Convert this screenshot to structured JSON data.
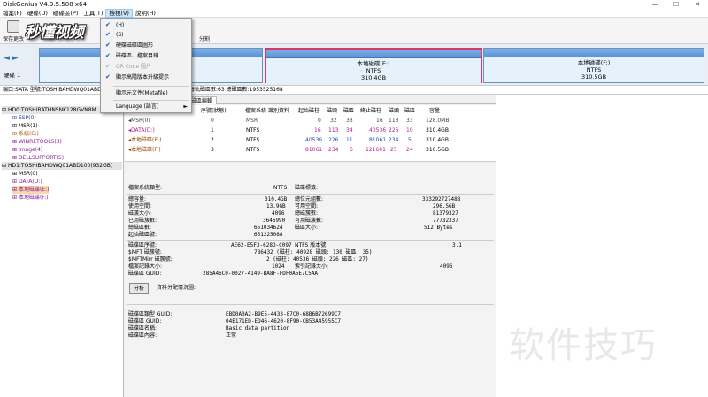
{
  "window": {
    "title": "DiskGenius V4.9.5.508 x64",
    "controls": [
      "—",
      "☐",
      "✕"
    ]
  },
  "menubar": {
    "items": [
      "檔案(F)",
      "硬碟(D)",
      "磁碟區(P)",
      "工具(T)",
      "檢視(V)",
      "說明(H)"
    ]
  },
  "toolbar": {
    "buttons": [
      "保存更改",
      "分割"
    ],
    "logo_text": "秒懂视频"
  },
  "view_menu": {
    "items": [
      {
        "label": "(H)",
        "checked": true,
        "disabled": false
      },
      {
        "label": "(S)",
        "checked": true,
        "disabled": false
      },
      {
        "label": "硬碟磁碟區圖形",
        "checked": true,
        "disabled": false
      },
      {
        "label": "磁碟區、檔案目錄",
        "checked": true,
        "disabled": false
      },
      {
        "label": "QR Code 圖片",
        "checked": true,
        "disabled": true
      },
      {
        "label": "顯示高階版本升級提示",
        "checked": true,
        "disabled": false
      },
      {
        "label": "顯示元文件(Metafile)",
        "checked": false,
        "disabled": false
      },
      {
        "label": "Language (語言)",
        "checked": false,
        "disabled": false,
        "submenu": "►"
      }
    ]
  },
  "diskmap": {
    "disk_label": "硬碟 1",
    "nav": "◄ ►",
    "partitions": [
      {
        "name": "",
        "fs": "",
        "size": ""
      },
      {
        "name": "本地磁碟(E:)",
        "fs": "NTFS",
        "size": "310.4GB"
      },
      {
        "name": "本地磁碟(F:)",
        "fs": "NTFS",
        "size": "310.5GB"
      }
    ]
  },
  "diskinfo": "端口:SATA  型號:TOSHIBAHDWQ01ABD100  ... 磁頭數:121601  磁頭數:255  每軌磁區數:63  總磁區數:1953525168",
  "tree": {
    "items": [
      {
        "text": "HD0:TOSHIBATHNSNK128GVN8M",
        "level": 0,
        "style": "hd"
      },
      {
        "text": "ESP(0)",
        "level": 1,
        "style": "blue"
      },
      {
        "text": "MSR(1)",
        "level": 1,
        "style": ""
      },
      {
        "text": "系統(C:)",
        "level": 1,
        "style": "orange"
      },
      {
        "text": "WINRETOOLS(3)",
        "level": 1,
        "style": "purple"
      },
      {
        "text": "Image(4)",
        "level": 1,
        "style": "purple"
      },
      {
        "text": "DELLSUPPORT(5)",
        "level": 1,
        "style": "purple"
      },
      {
        "text": "HD1:TOSHIBAHDWQ01ABD100(932GB)",
        "level": 0,
        "style": "hd"
      },
      {
        "text": "MSR(0)",
        "level": 1,
        "style": ""
      },
      {
        "text": "DATA(D:)",
        "level": 1,
        "style": "purple"
      },
      {
        "text": "本地磁碟(E:)",
        "level": 1,
        "style": "hl"
      },
      {
        "text": "本地磁碟(F:)",
        "level": 1,
        "style": "purple"
      }
    ]
  },
  "tabs": [
    "磁區編輯"
  ],
  "table": {
    "headers": [
      "磁碟標籤",
      "序號(狀態)",
      "檔案系統",
      "識別資料",
      "起始磁柱",
      "磁頭",
      "磁區",
      "終止磁柱",
      "磁頭",
      "磁區",
      "容量"
    ],
    "rows": [
      [
        "MSR(0)",
        "0",
        "MSR",
        "",
        "0",
        "32",
        "33",
        "16",
        "113",
        "33",
        "128.0MB"
      ],
      [
        "DATA(D:)",
        "1",
        "NTFS",
        "",
        "16",
        "113",
        "34",
        "40536",
        "226",
        "10",
        "310.4GB"
      ],
      [
        "本地磁碟(E:)",
        "2",
        "NTFS",
        "",
        "40536",
        "226",
        "11",
        "81061",
        "234",
        "5",
        "310.4GB"
      ],
      [
        "本地磁碟(F:)",
        "3",
        "NTFS",
        "",
        "81061",
        "234",
        "6",
        "121601",
        "25",
        "24",
        "310.5GB"
      ]
    ]
  },
  "details": {
    "fs_type_label": "檔案系統類型:",
    "fs_type_value": "NTFS",
    "volume_label": "磁碟標籤:",
    "left": [
      [
        "總容量:",
        "310.4GB"
      ],
      [
        "使用空間:",
        "13.9GB"
      ],
      [
        "磁簇大小:",
        "4096"
      ],
      [
        "已用磁簇數:",
        "3646990"
      ],
      [
        "總磁區數:",
        "651034624"
      ],
      [
        "起始磁區號:",
        "651225088"
      ]
    ],
    "right": [
      [
        "總位元組數:",
        "333292727488"
      ],
      [
        "可用空間:",
        "296.5GB"
      ],
      [
        "總磁簇數:",
        "81379327"
      ],
      [
        "可用磁簇數:",
        "77732337"
      ],
      [
        "磁區大小:",
        "512 Bytes"
      ]
    ],
    "ntfs": [
      [
        "磁碟區序號:",
        "AE62-E5F3-628D-C097",
        "NTFS 版本號:",
        "3.1"
      ],
      [
        "$MFT 磁簇號:",
        "786432 (磁柱: 40928 磁頭: 130 磁區: 35)",
        "",
        ""
      ],
      [
        "$MFTMirr 磁簇號:",
        "2 (磁柱: 40536 磁頭: 226 磁區: 27)",
        "",
        ""
      ],
      [
        "檔案記錄大小:",
        "1024",
        "索引記錄大小:",
        "4096"
      ],
      [
        "磁碟區 GUID:",
        "285A46C0-0027-4149-BA8F-FDF0A5E7C5AA",
        "",
        ""
      ]
    ],
    "analyze_button": "分析",
    "alloc_label": "資料分配情況圖:",
    "guid": [
      [
        "磁碟區類型 GUID:",
        "EBD0A0A2-B9E5-4433-87C0-68B6B72699C7"
      ],
      [
        "磁碟區 GUID:",
        "04E171ED-ED46-4620-8F90-CB53A45955C7"
      ],
      [
        "磁碟區名稱:",
        "Basic data partition"
      ],
      [
        "磁碟區內容:",
        "正常"
      ]
    ]
  },
  "watermark": "软件技巧"
}
